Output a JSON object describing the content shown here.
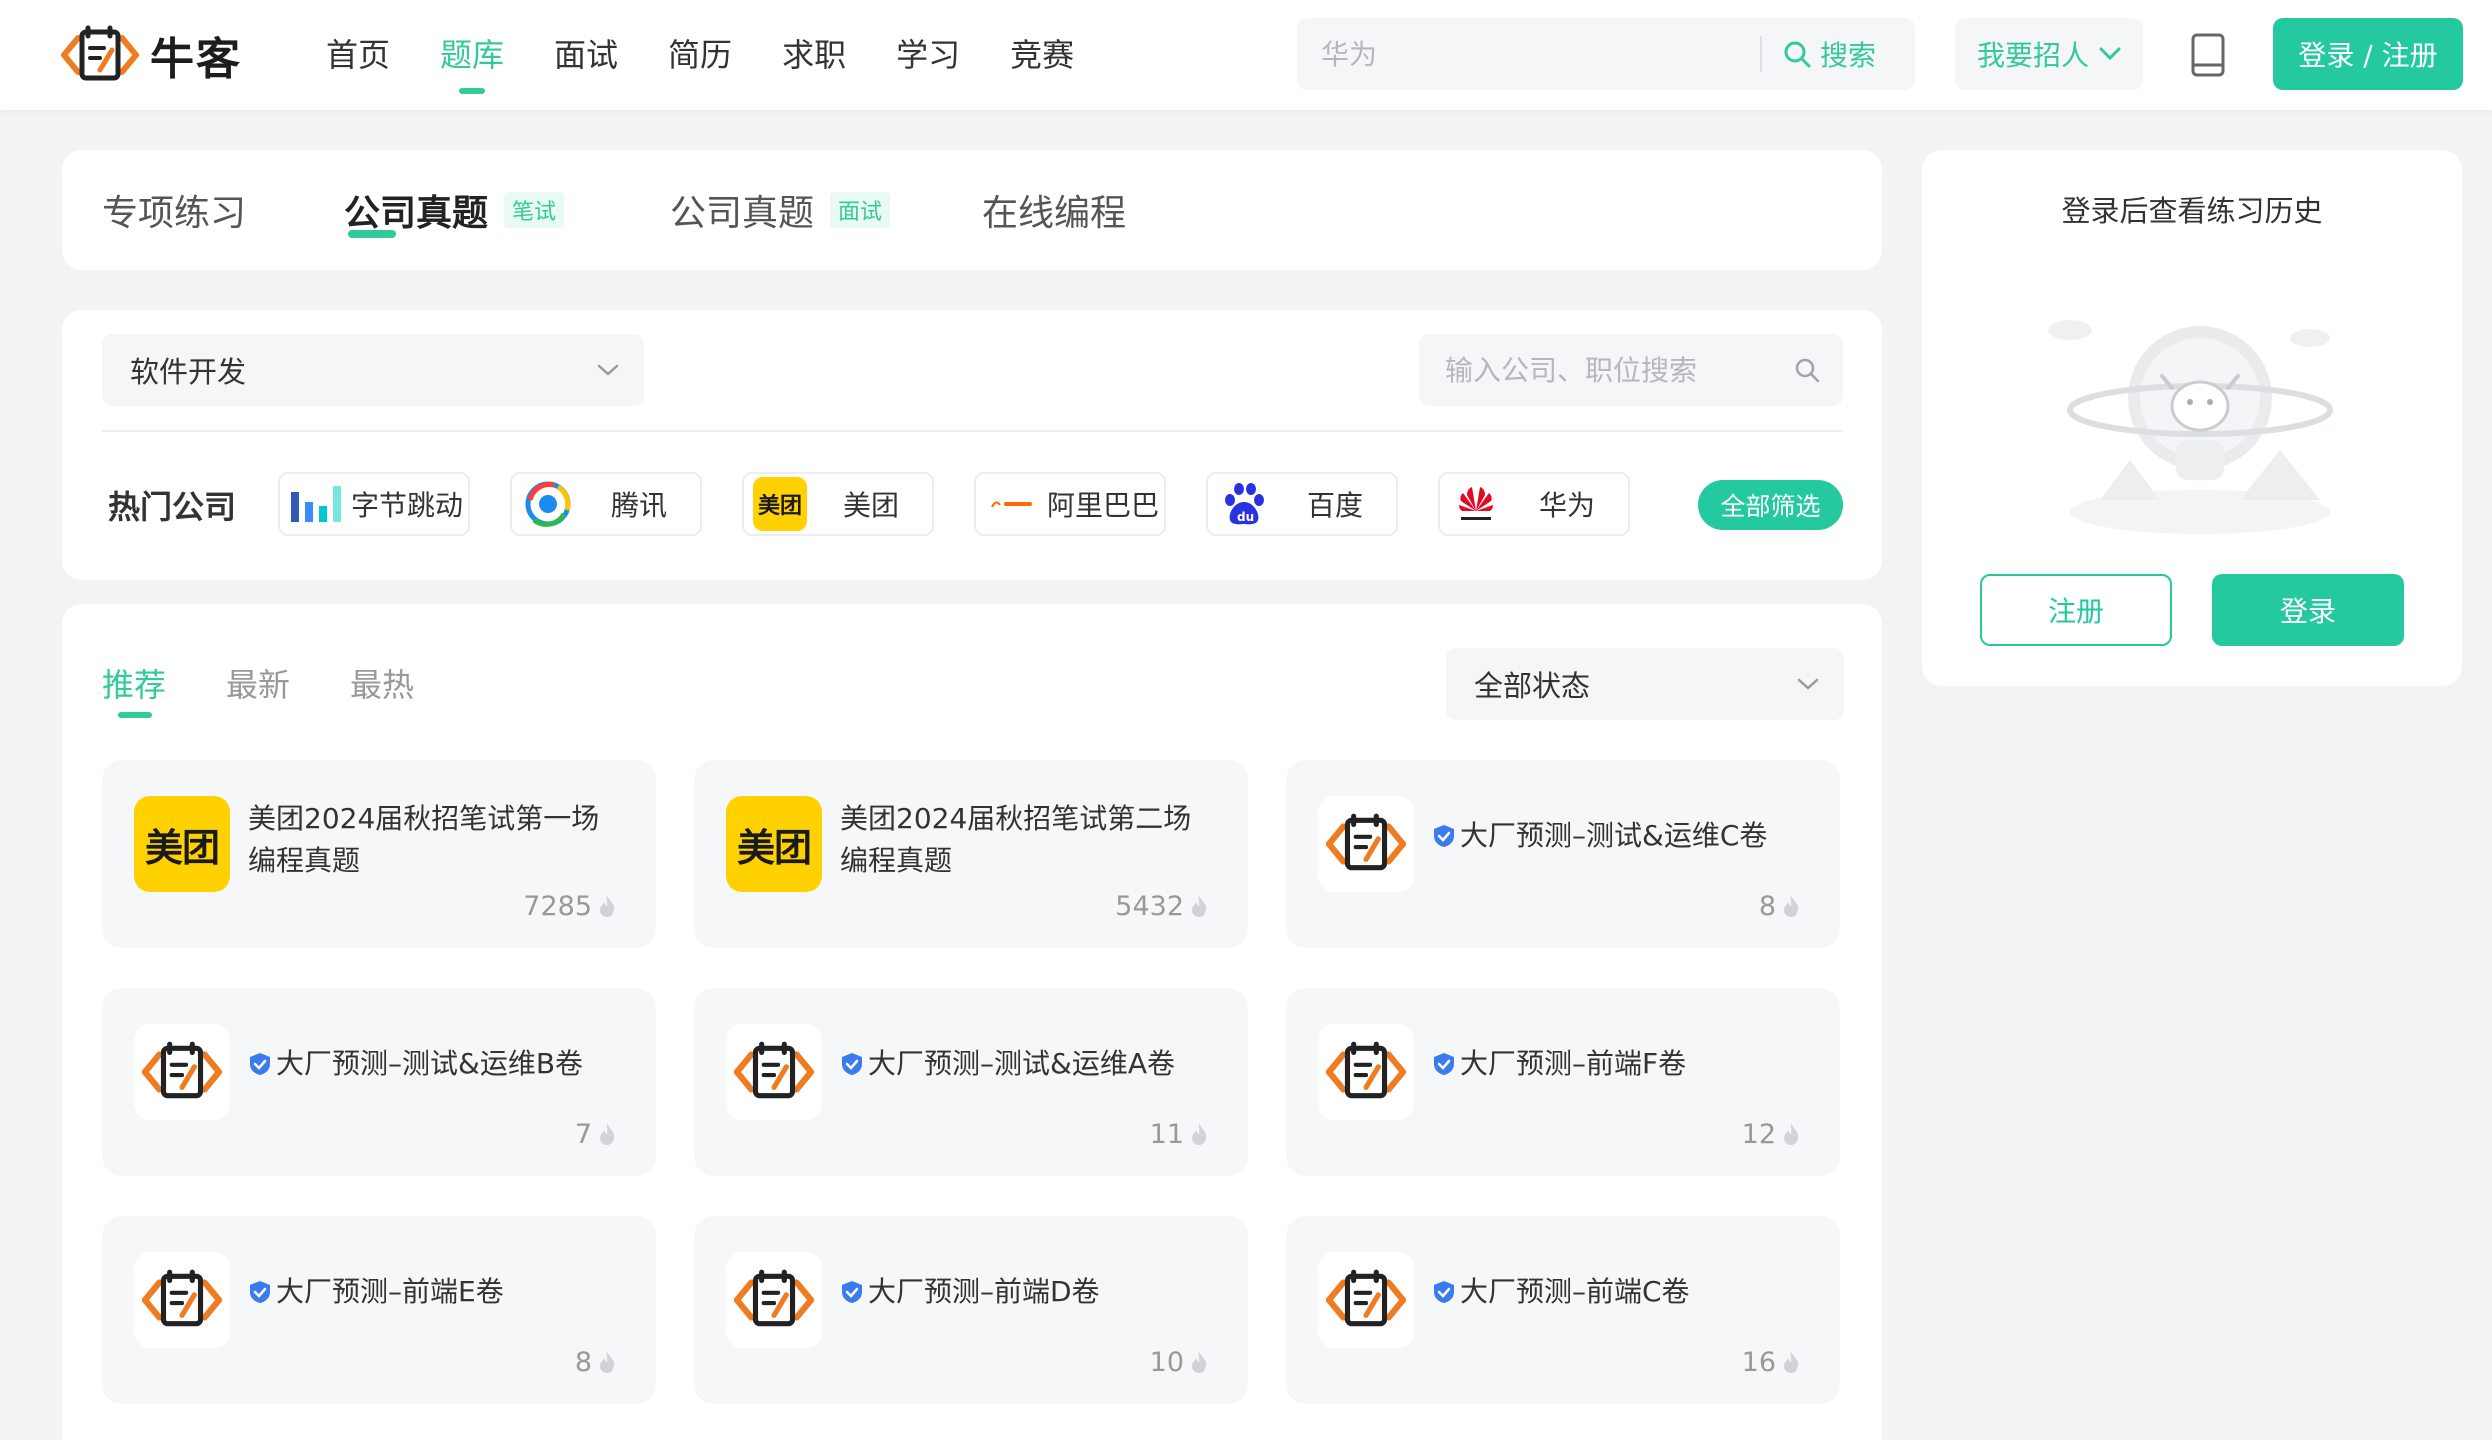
{
  "header": {
    "logo_text": "牛客",
    "nav": [
      "首页",
      "题库",
      "面试",
      "简历",
      "求职",
      "学习",
      "竞赛"
    ],
    "active_nav": "题库",
    "search": {
      "placeholder": "华为",
      "button_label": "搜索"
    },
    "recruit_label": "我要招人",
    "login_label": "登录 / 注册"
  },
  "practice_tabs": [
    {
      "label": "专项练习",
      "badge": ""
    },
    {
      "label": "公司真题",
      "badge": "笔试"
    },
    {
      "label": "公司真题",
      "badge": "面试"
    },
    {
      "label": "在线编程",
      "badge": ""
    }
  ],
  "filter": {
    "category_value": "软件开发",
    "company_search_placeholder": "输入公司、职位搜索",
    "hot_label": "热门公司",
    "companies": [
      "字节跳动",
      "腾讯",
      "美团",
      "阿里巴巴",
      "百度",
      "华为"
    ],
    "all_filter_label": "全部筛选"
  },
  "list": {
    "sort_tabs": [
      "推荐",
      "最新",
      "最热"
    ],
    "status_value": "全部状态",
    "items": [
      {
        "logo": "美团",
        "title_line1": "美团2024届秋招笔试第一场",
        "title_line2": "编程真题",
        "count": "7285"
      },
      {
        "logo": "美团",
        "title_line1": "美团2024届秋招笔试第二场",
        "title_line2": "编程真题",
        "count": "5432"
      },
      {
        "logo": "nowcoder",
        "title": "大厂预测–测试&运维C卷",
        "count": "8"
      },
      {
        "logo": "nowcoder",
        "title": "大厂预测–测试&运维B卷",
        "count": "7"
      },
      {
        "logo": "nowcoder",
        "title": "大厂预测–测试&运维A卷",
        "count": "11"
      },
      {
        "logo": "nowcoder",
        "title": "大厂预测–前端F卷",
        "count": "12"
      },
      {
        "logo": "nowcoder",
        "title": "大厂预测–前端E卷",
        "count": "8"
      },
      {
        "logo": "nowcoder",
        "title": "大厂预测–前端D卷",
        "count": "10"
      },
      {
        "logo": "nowcoder",
        "title": "大厂预测–前端C卷",
        "count": "16"
      }
    ]
  },
  "side": {
    "title": "登录后查看练习历史",
    "register_label": "注册",
    "login_label": "登录"
  },
  "colors": {
    "accent": "#32ca99",
    "button": "#25c9a0",
    "meituan": "#ffd100"
  }
}
